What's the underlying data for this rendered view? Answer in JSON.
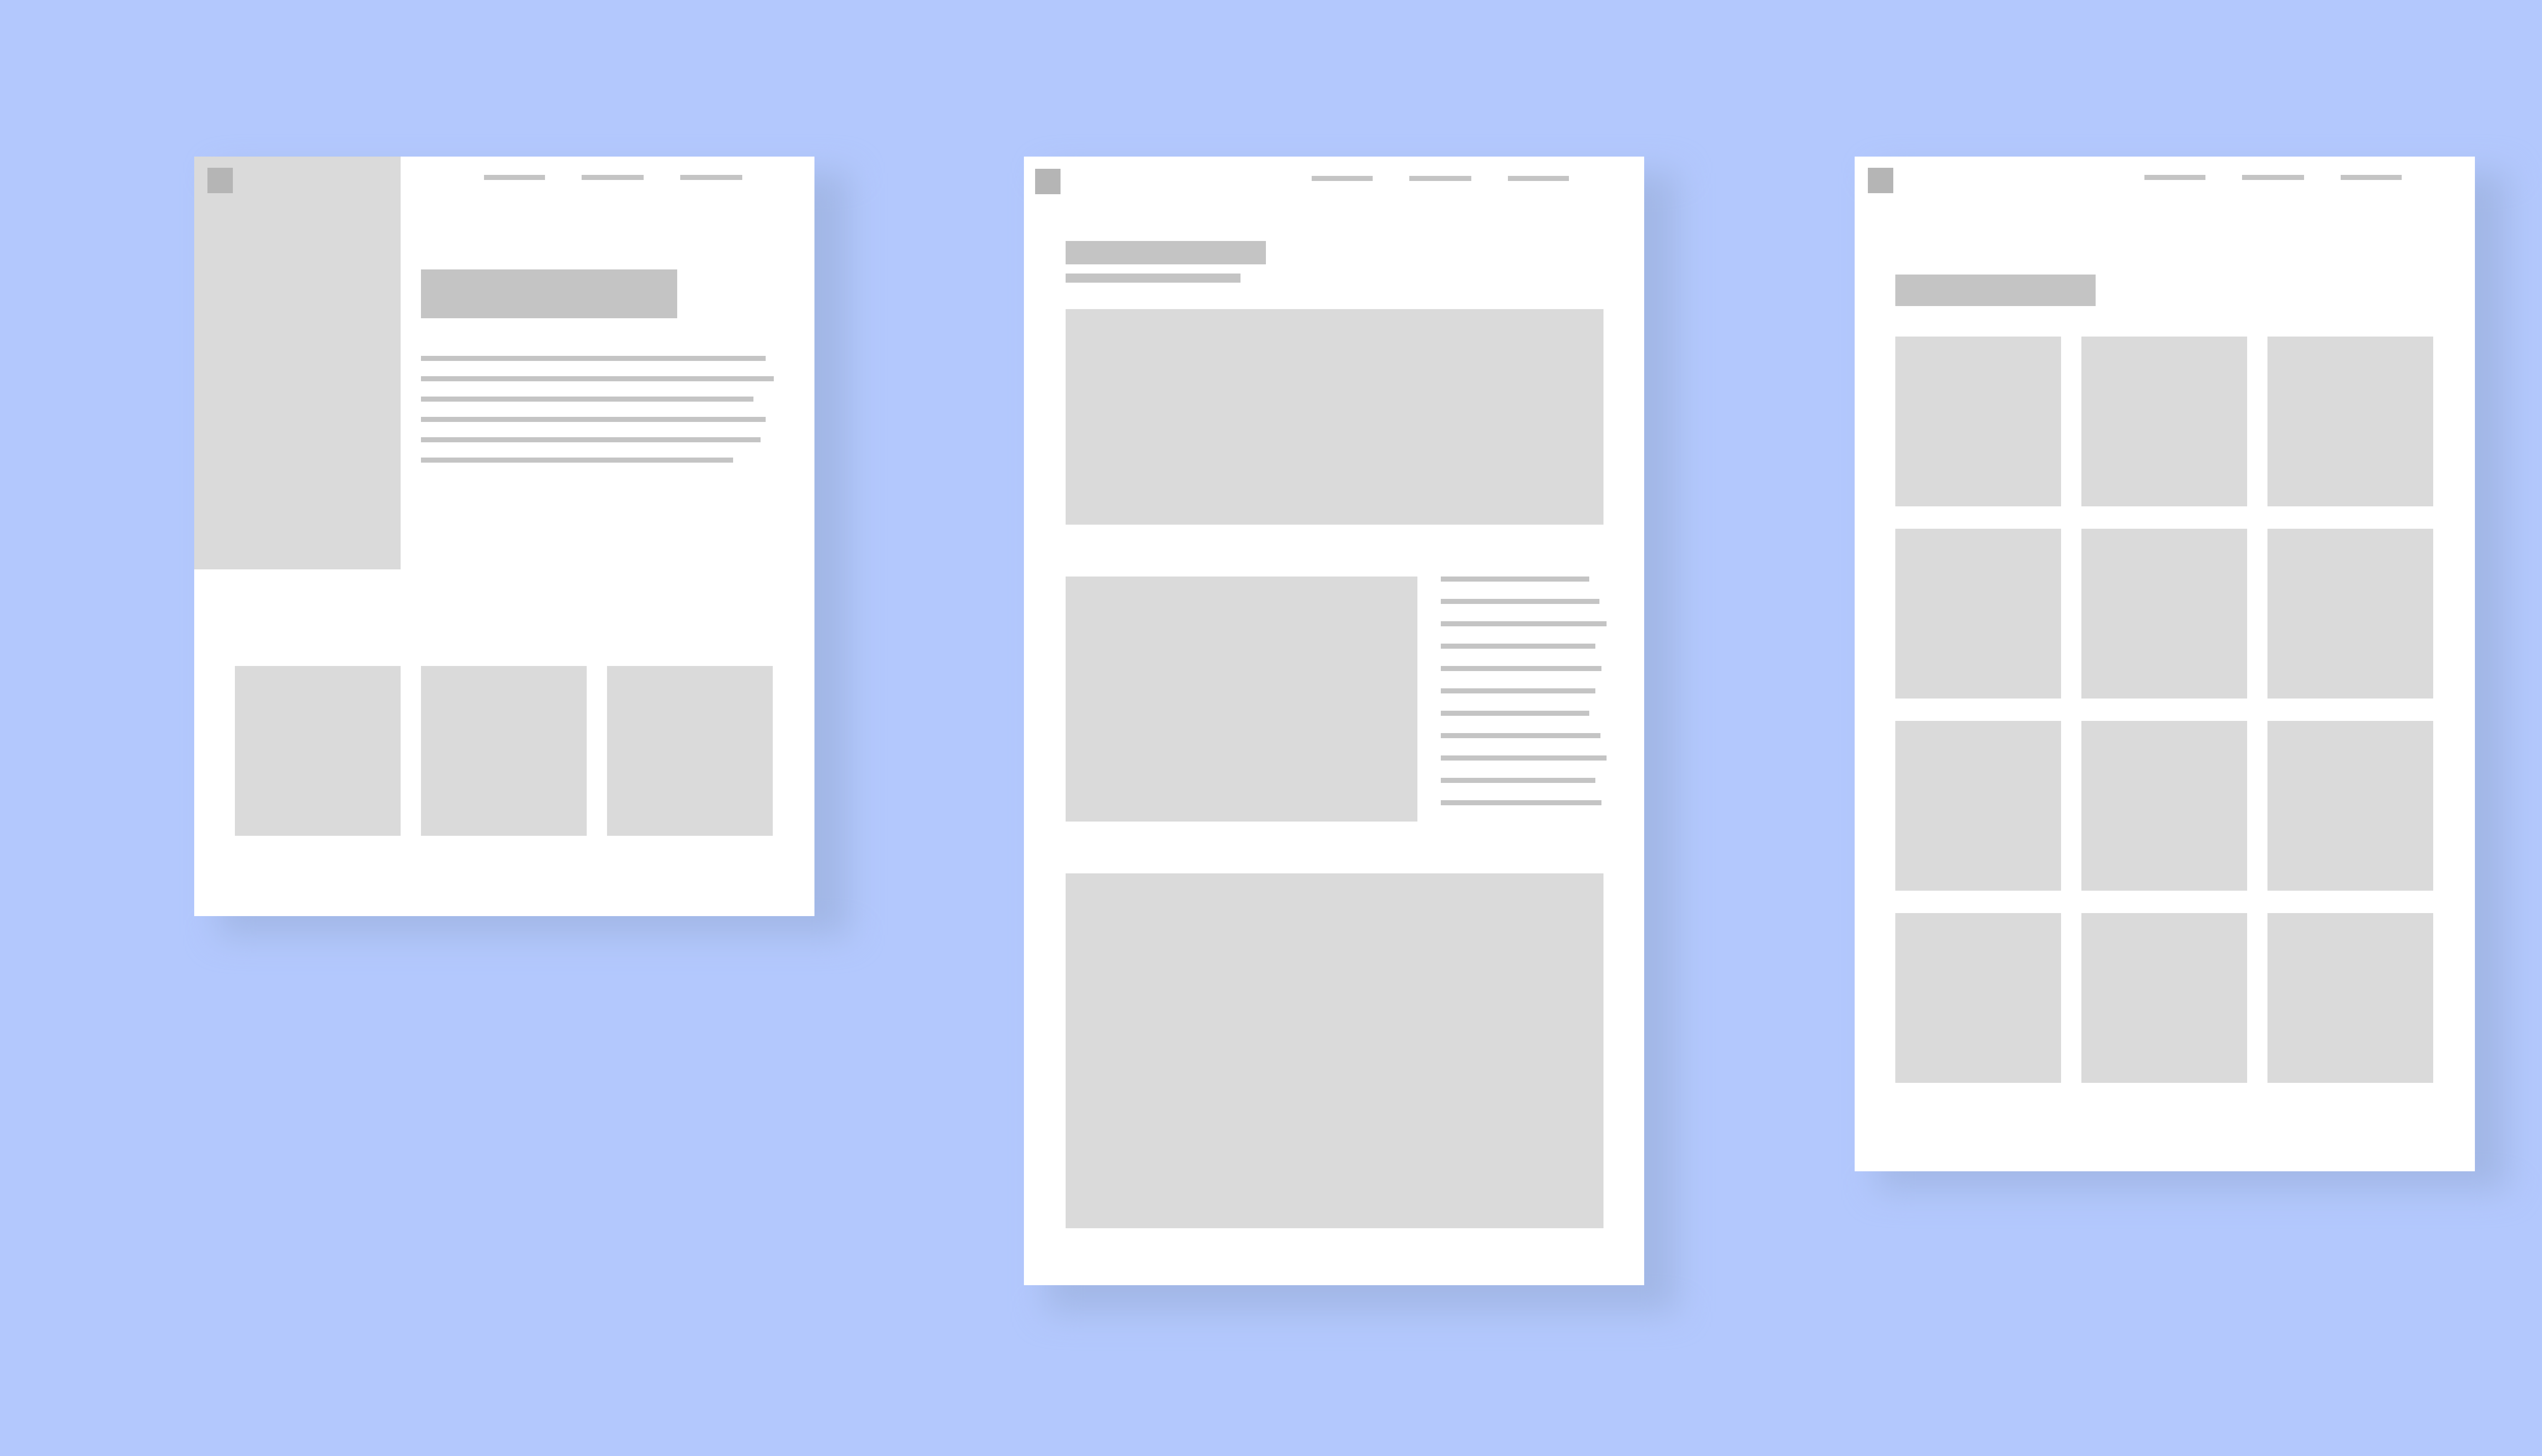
{
  "canvas": {
    "background_color": "#b3c8fd",
    "shadow_color": "#a2b7e6"
  },
  "wireframe": {
    "page_color": "#ffffff",
    "placeholder_color": "#dadada",
    "text_line_color": "#c4c4c4",
    "logo_color": "#b5b5b5"
  },
  "pages": [
    {
      "name": "sidebar-layout",
      "nav_item_count": 3,
      "paragraph_line_count": 6,
      "card_count": 3
    },
    {
      "name": "article-layout",
      "nav_item_count": 3,
      "paragraph_line_count": 11,
      "image_block_count": 3
    },
    {
      "name": "grid-layout",
      "nav_item_count": 3,
      "grid_columns": 3,
      "grid_rows": 4
    }
  ]
}
